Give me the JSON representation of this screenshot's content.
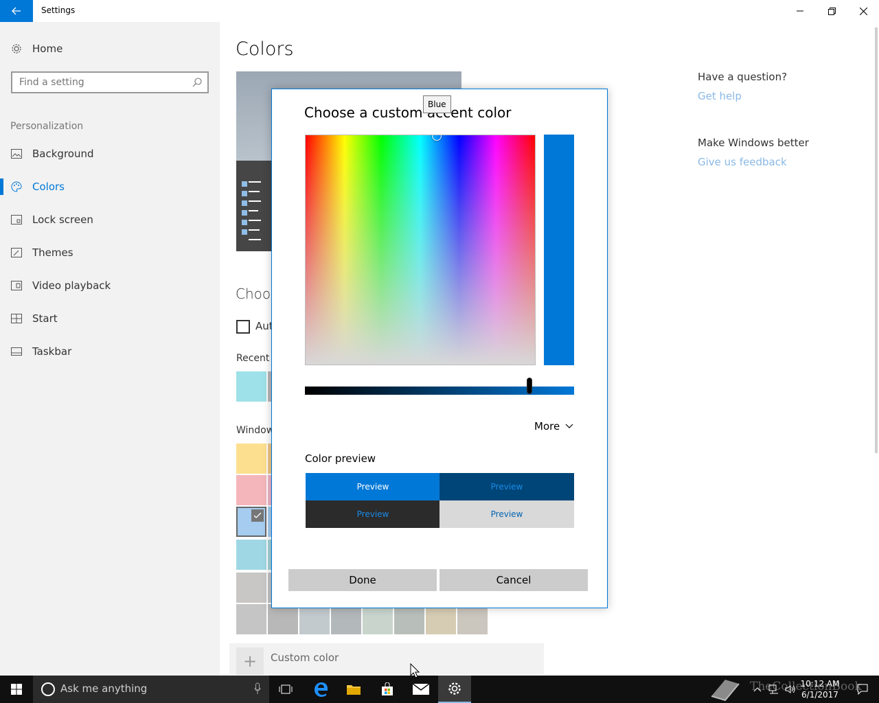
{
  "window": {
    "title": "Settings"
  },
  "sidebar": {
    "home_label": "Home",
    "search_placeholder": "Find a setting",
    "section_label": "Personalization",
    "items": [
      {
        "label": "Background",
        "icon": "picture-icon"
      },
      {
        "label": "Colors",
        "icon": "palette-icon",
        "active": true
      },
      {
        "label": "Lock screen",
        "icon": "lock-screen-icon"
      },
      {
        "label": "Themes",
        "icon": "brush-icon"
      },
      {
        "label": "Video playback",
        "icon": "video-icon"
      },
      {
        "label": "Start",
        "icon": "start-grid-icon"
      },
      {
        "label": "Taskbar",
        "icon": "taskbar-icon"
      }
    ]
  },
  "main": {
    "title": "Colors",
    "choose_heading_partial": "Choos",
    "auto_checkbox_partial": "Aut",
    "recent_label_partial": "Recent c",
    "windows_label_partial": "Window",
    "custom_color_label": "Custom color",
    "swatch_colors": {
      "recent": [
        "#9ee1e8",
        "#b8b8b8"
      ],
      "row1": [
        "#fde08f",
        "#f0c989"
      ],
      "row2": [
        "#f4b6bb",
        "#f0b6c8"
      ],
      "row3_selected": "#a6ccf0",
      "row4": [
        "#9fd8e4",
        "#a2d4da"
      ],
      "row5": [
        "#c8c7c5",
        "#c4c4c4"
      ],
      "row6": [
        "#c5c5c5",
        "#b8b8b8",
        "#c2cacd",
        "#b3b8bb",
        "#c9d5cc",
        "#b8bfba",
        "#d6ccb4",
        "#cbc6be"
      ]
    }
  },
  "right_panel": {
    "question": "Have a question?",
    "help_link": "Get help",
    "feedback_heading": "Make Windows better",
    "feedback_link": "Give us feedback"
  },
  "dialog": {
    "title": "Choose a custom accent color",
    "tooltip": "Blue",
    "selected_color": "#0078d7",
    "value_level": 0.835,
    "more_label": "More",
    "preview_label": "Color preview",
    "previews": [
      {
        "text": "Preview",
        "bg": "#0078d7",
        "fg": "#ffffff"
      },
      {
        "text": "Preview",
        "bg": "#004578",
        "fg": "#1a8ae6"
      },
      {
        "text": "Preview",
        "bg": "#2b2b2b",
        "fg": "#1a8ae6"
      },
      {
        "text": "Preview",
        "bg": "#d9d9d9",
        "fg": "#0063b1"
      }
    ],
    "done_label": "Done",
    "cancel_label": "Cancel"
  },
  "taskbar": {
    "search_placeholder": "Ask me anything",
    "time": "10:12 AM",
    "date": "6/1/2017",
    "watermark": "TheCollectionBook"
  },
  "colors": {
    "accent": "#0078d7",
    "sidebar_bg": "#f2f2f2",
    "taskbar_bg": "#101010"
  }
}
